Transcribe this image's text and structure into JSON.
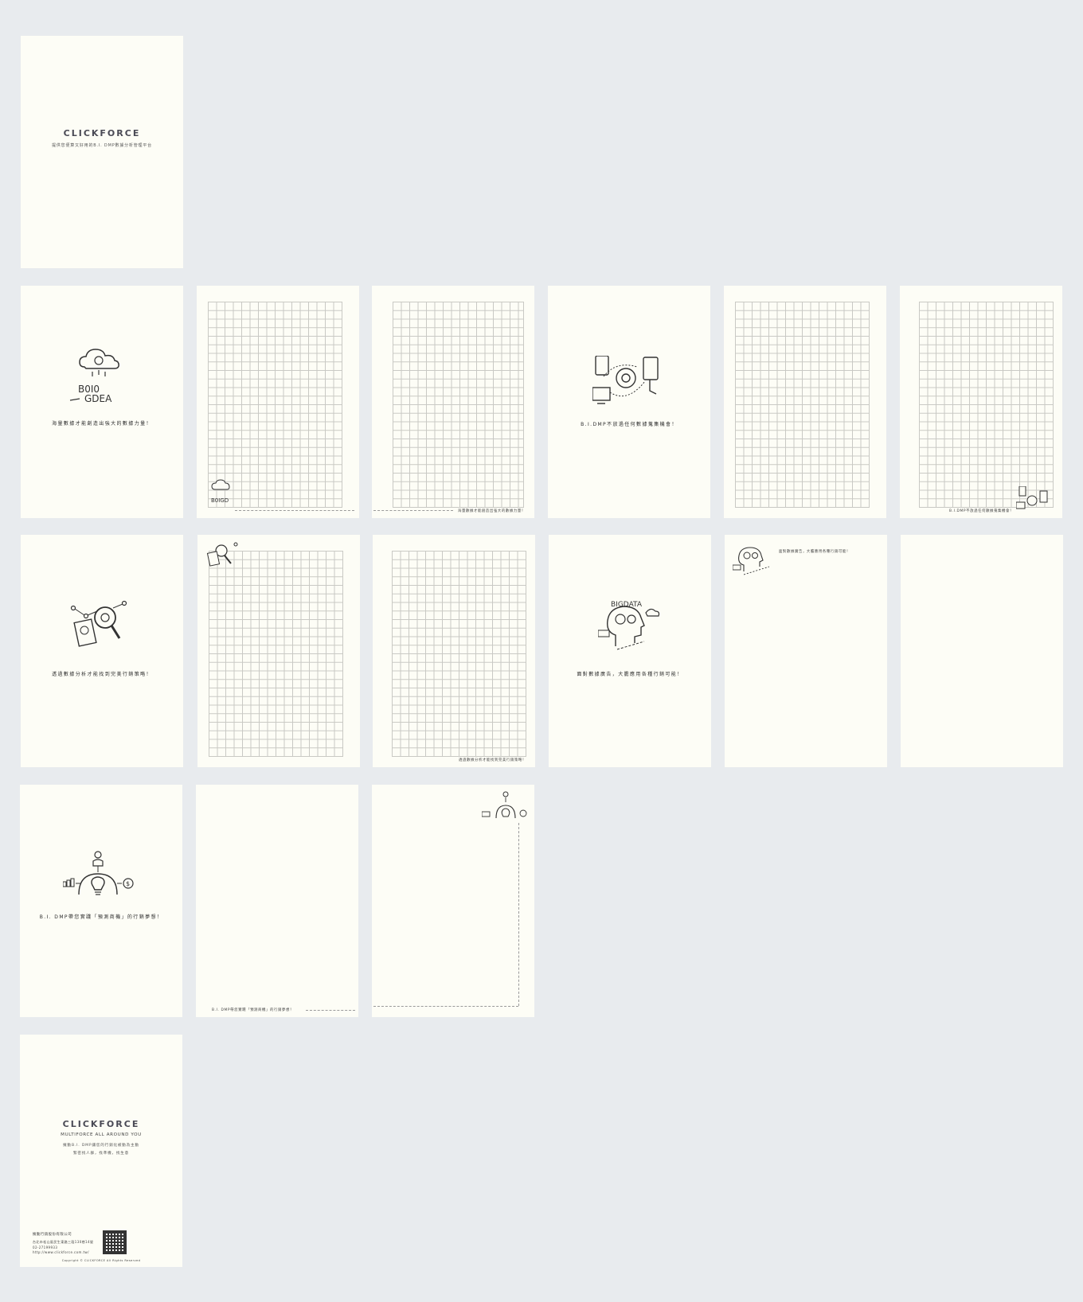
{
  "cover": {
    "brand": "CLICKFORCE",
    "tagline": "提供您便算又好用的B.I. DMP數據分析管理平台"
  },
  "captions": {
    "p1": "海量數據才能創造出強大的數據力量！",
    "p2": "B.I.DMP不放過任何數據蒐集機會！",
    "p3": "透過數據分析才能找到完美行銷策略！",
    "p4": "面對數據廣告，大膽應用各種行銷可能！",
    "p5": "B.I. DMP帶您實踐「預測商機」的行銷夢想！"
  },
  "back": {
    "brand": "CLICKFORCE",
    "slogan": "MULTIFORCE ALL AROUND YOU",
    "line1": "擁動B.I. DMP讓您的行銷化被動為主動",
    "line2": "緊密找人群，找準機，找生意",
    "company": "擁動行銷股份有限公司",
    "address": "台北市松山區民生東路三段130巷14號",
    "phone": "02-27199933",
    "url": "http://www.clickforce.com.tw/",
    "copyright": "Copyright © CLICKFORCE All Rights Reserved"
  }
}
